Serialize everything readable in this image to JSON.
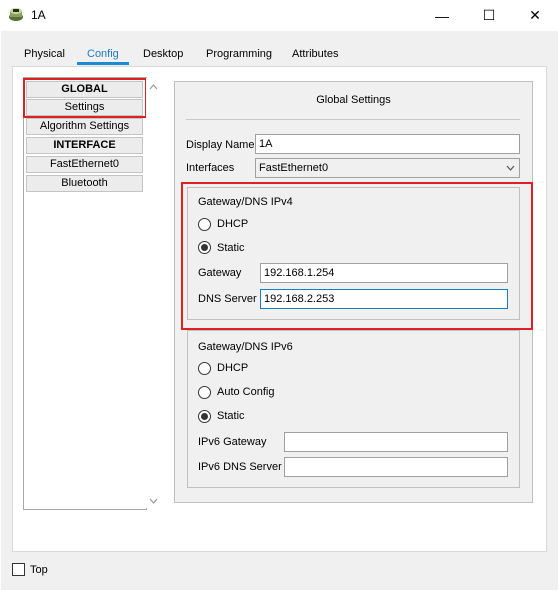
{
  "window": {
    "title": "1A",
    "minimize_icon": "minimize-icon",
    "maximize_icon": "maximize-icon",
    "close_icon": "close-icon",
    "minimize_glyph": "—",
    "maximize_glyph": "☐",
    "close_glyph": "✕"
  },
  "tabs": [
    {
      "label": "Physical"
    },
    {
      "label": "Config",
      "active": true
    },
    {
      "label": "Desktop"
    },
    {
      "label": "Programming"
    },
    {
      "label": "Attributes"
    }
  ],
  "sidebar": {
    "items": [
      {
        "label": "GLOBAL",
        "bold": true
      },
      {
        "label": "Settings"
      },
      {
        "label": "Algorithm Settings"
      },
      {
        "label": "INTERFACE",
        "bold": true
      },
      {
        "label": "FastEthernet0"
      },
      {
        "label": "Bluetooth"
      }
    ]
  },
  "settings": {
    "title": "Global Settings",
    "display_name_label": "Display Name",
    "display_name_value": "1A",
    "interfaces_label": "Interfaces",
    "interfaces_value": "FastEthernet0",
    "ipv4": {
      "title": "Gateway/DNS IPv4",
      "dhcp_label": "DHCP",
      "static_label": "Static",
      "selected": "Static",
      "gateway_label": "Gateway",
      "gateway_value": "192.168.1.254",
      "dns_label": "DNS Server",
      "dns_value": "192.168.2.253"
    },
    "ipv6": {
      "title": "Gateway/DNS IPv6",
      "dhcp_label": "DHCP",
      "auto_label": "Auto Config",
      "static_label": "Static",
      "selected": "Static",
      "gateway_label": "IPv6 Gateway",
      "gateway_value": "",
      "dns_label": "IPv6 DNS Server",
      "dns_value": ""
    }
  },
  "footer": {
    "top_label": "Top",
    "top_checked": false
  },
  "colors": {
    "accent": "#1a7bc8",
    "highlight": "#e02020"
  }
}
